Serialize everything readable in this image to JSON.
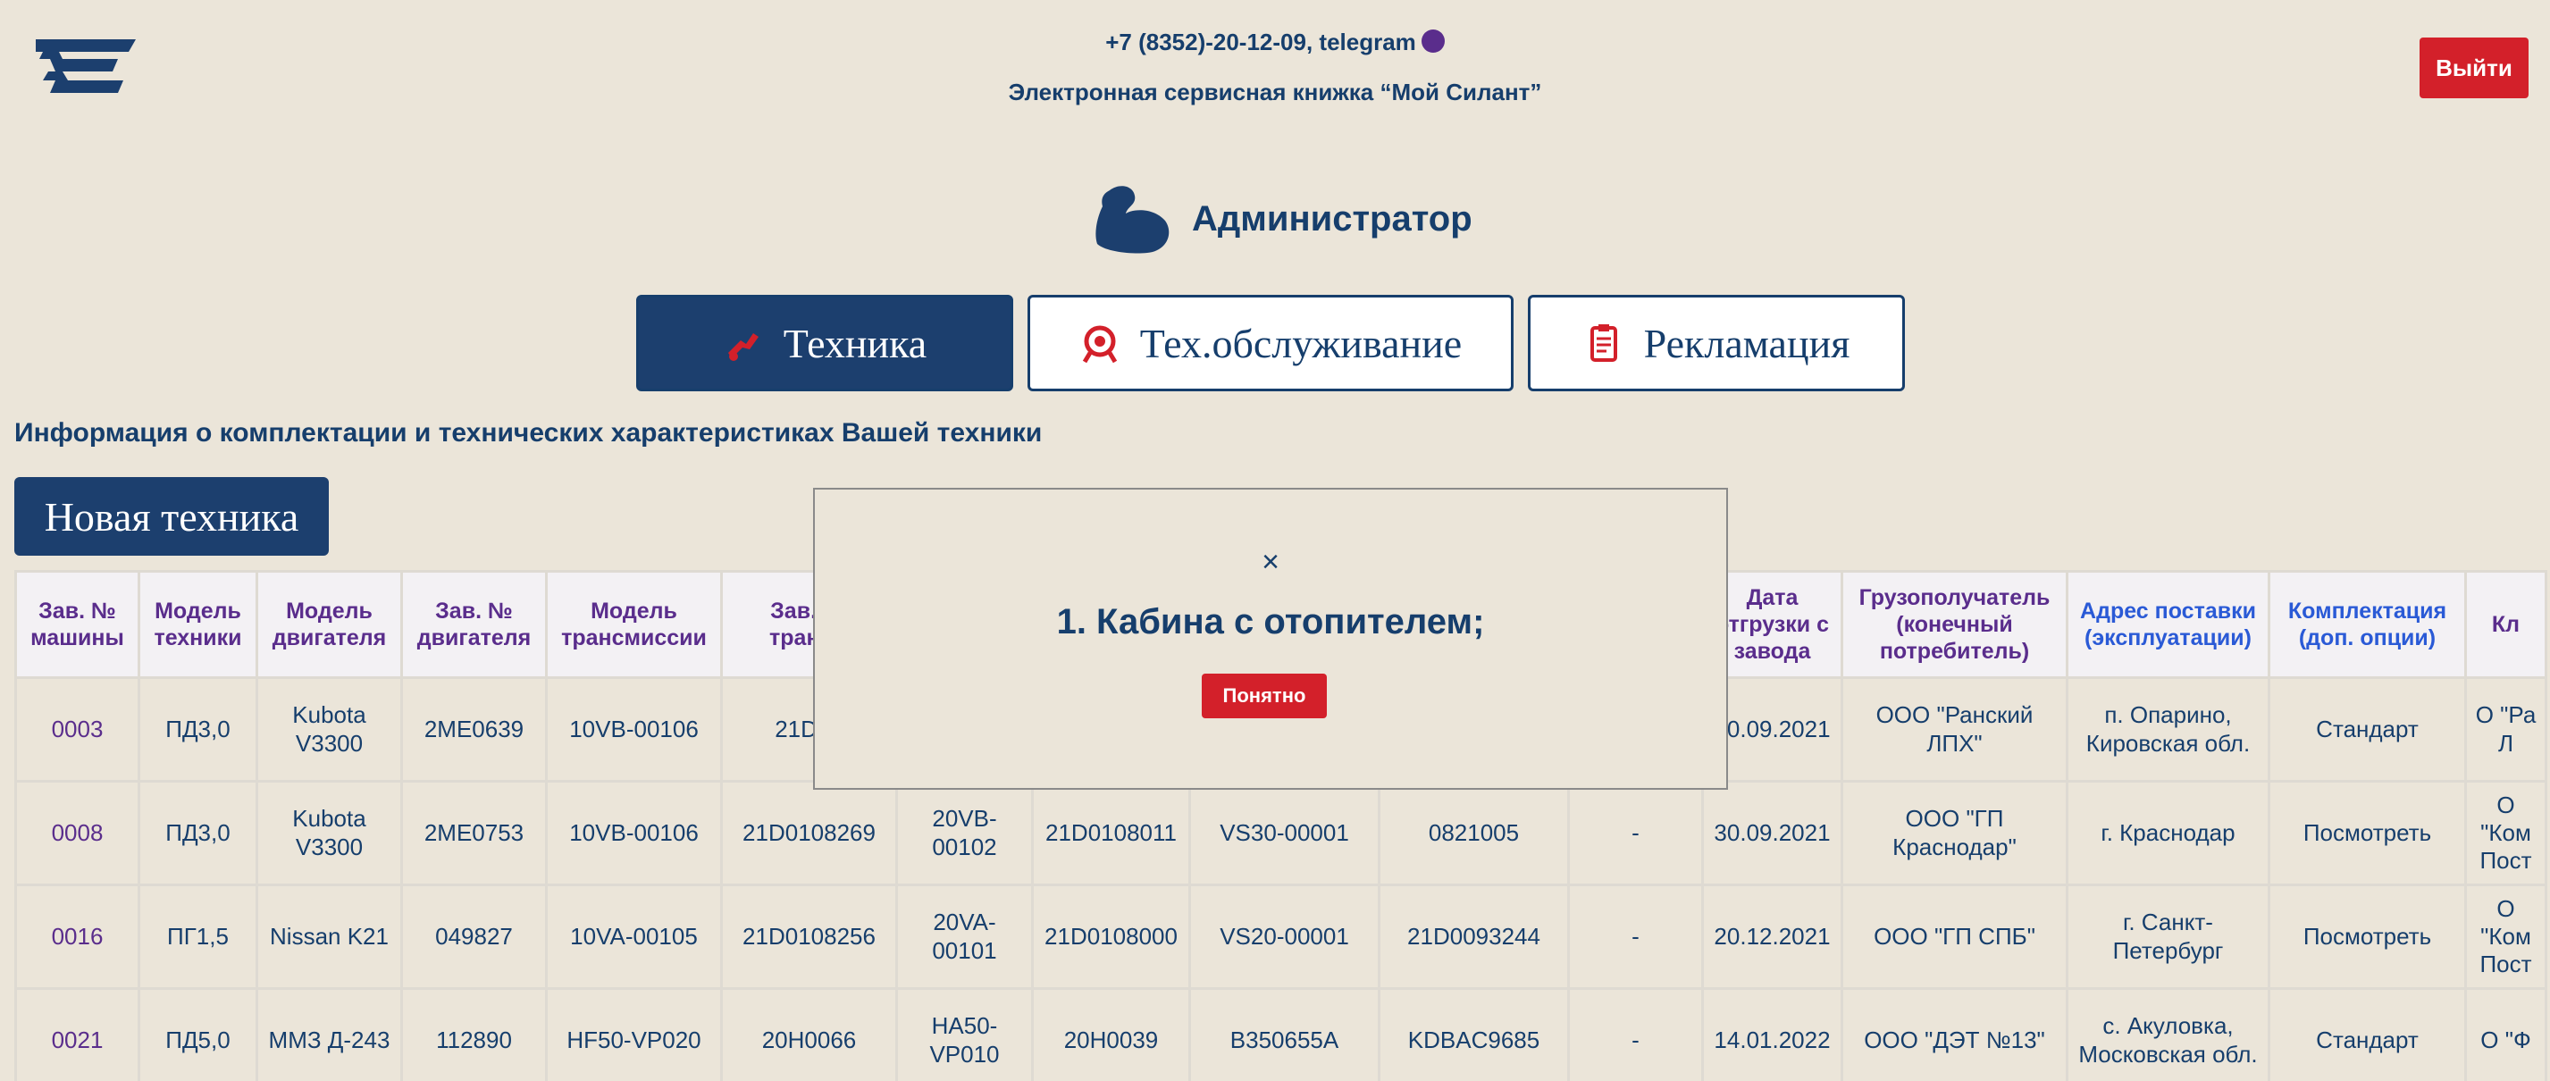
{
  "header": {
    "contact": "+7 (8352)-20-12-09, telegram",
    "subtitle": "Электронная сервисная книжка “Мой Силант”",
    "logout_label": "Выйти",
    "role": "Администратор"
  },
  "tabs": [
    {
      "label": "Техника",
      "active": true,
      "icon": "forklift-icon"
    },
    {
      "label": "Тех.обслуживание",
      "active": false,
      "icon": "service-gear-icon"
    },
    {
      "label": "Рекламация",
      "active": false,
      "icon": "clipboard-icon"
    }
  ],
  "info_text": "Информация о комплектации и технических характеристиках Вашей техники",
  "new_button": "Новая техника",
  "table": {
    "headers": [
      "Зав. № машины",
      "Модель техники",
      "Модель двигателя",
      "Зав. № двигателя",
      "Модель трансмиссии",
      "Зав. № трансм",
      "",
      "",
      "",
      "",
      "",
      "Дата отгрузки с завода",
      "Грузополучатель (конечный потребитель)",
      "Адрес поставки (эксплуатации)",
      "Комплектация (доп. опции)",
      "Кл"
    ],
    "rows": [
      [
        "0003",
        "ПД3,0",
        "Kubota V3300",
        "2ME0639",
        "10VB-00106",
        "21D01",
        "",
        "",
        "",
        "",
        "",
        "30.09.2021",
        "ООО \"Ранский ЛПХ\"",
        "п. Опарино, Кировская обл.",
        "Стандарт",
        "О \"Ра Л"
      ],
      [
        "0008",
        "ПД3,0",
        "Kubota V3300",
        "2ME0753",
        "10VB-00106",
        "21D0108269",
        "20VB-00102",
        "21D0108011",
        "VS30-00001",
        "0821005",
        "-",
        "30.09.2021",
        "ООО \"ГП Краснодар\"",
        "г. Краснодар",
        "Посмотреть",
        "О \"Ком Пост"
      ],
      [
        "0016",
        "ПГ1,5",
        "Nissan K21",
        "049827",
        "10VA-00105",
        "21D0108256",
        "20VA-00101",
        "21D0108000",
        "VS20-00001",
        "21D0093244",
        "-",
        "20.12.2021",
        "ООО \"ГП СПБ\"",
        "г. Санкт-Петербург",
        "Посмотреть",
        "О \"Ком Пост"
      ],
      [
        "0021",
        "ПД5,0",
        "ММЗ Д-243",
        "112890",
        "HF50-VP020",
        "20H0066",
        "HA50-VP010",
        "20H0039",
        "B350655A",
        "KDBAC9685",
        "-",
        "14.01.2022",
        "ООО \"ДЭТ №13\"",
        "с. Акуловка, Московская обл.",
        "Стандарт",
        "О \"Ф"
      ]
    ]
  },
  "modal": {
    "close": "×",
    "message": "1. Кабина с отопителем;",
    "ok_label": "Понятно"
  },
  "colors": {
    "background": "#ebe5d9",
    "primary": "#1c3f6e",
    "accent_red": "#d3202a",
    "link_purple": "#5a2d8c",
    "link_blue": "#2a5ad6"
  }
}
